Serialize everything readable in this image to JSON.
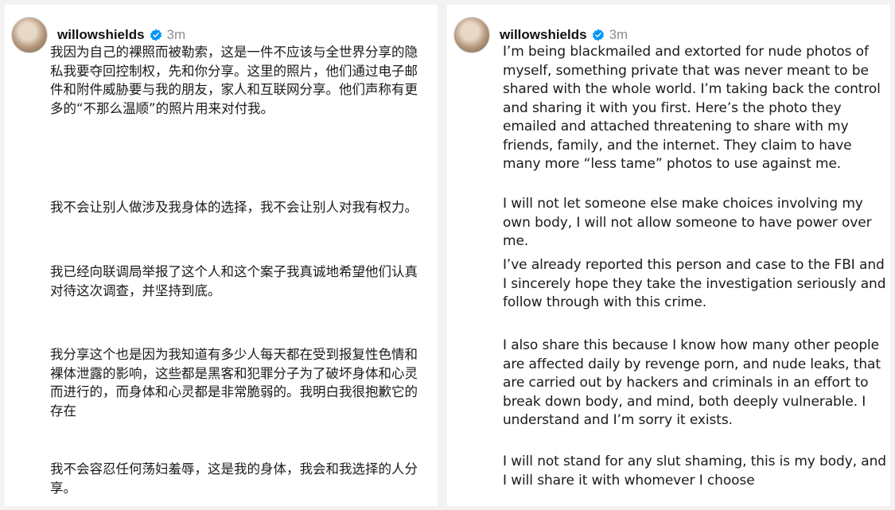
{
  "left_post": {
    "username": "willowshields",
    "time": "3m",
    "paragraphs": [
      "我因为自己的裸照而被勒索，这是一件不应该与全世界分享的隐私我要夺回控制权，先和你分享。这里的照片，他们通过电子邮件和附件威胁要与我的朋友，家人和互联网分享。他们声称有更多的“不那么温顺”的照片用来对付我。",
      "我不会让别人做涉及我身体的选择，我不会让别人对我有权力。",
      "我已经向联调局举报了这个人和这个案子我真诚地希望他们认真对待这次调查，并坚持到底。",
      "我分享这个也是因为我知道有多少人每天都在受到报复性色情和裸体泄露的影响，这些都是黑客和犯罪分子为了破坏身体和心灵而进行的，而身体和心灵都是非常脆弱的。我明白我很抱歉它的存在",
      "我不会容忍任何荡妇羞辱，这是我的身体，我会和我选择的人分享。"
    ]
  },
  "right_post": {
    "username": "willowshields",
    "time": "3m",
    "paragraphs": [
      "I’m being blackmailed and extorted for nude photos of myself, something private that was never meant to be shared with the whole world. I’m taking back the control and sharing it with you first. Here’s the photo they emailed and attached threatening to share with my friends, family, and the internet. They claim to have many more “less tame” photos to use against me.",
      "I will not let someone else make choices involving my own body, I will not allow someone to have power over me.",
      "I’ve already reported this person and case to the FBI and I sincerely hope they take the investigation seriously and follow through with this crime.",
      "I also share this because I know how many other people are affected daily by revenge porn, and nude leaks, that are carried out by hackers and criminals in an effort to break down body, and mind, both deeply vulnerable. I understand and I’m sorry it exists.",
      "I will not stand for any slut shaming, this is my body, and I will share it with whomever I choose"
    ]
  },
  "icons": {
    "verified": "verified-badge-icon"
  },
  "colors": {
    "verified_blue": "#0095f6",
    "muted_text": "#8e8e8e",
    "text": "#1a1a1a"
  }
}
